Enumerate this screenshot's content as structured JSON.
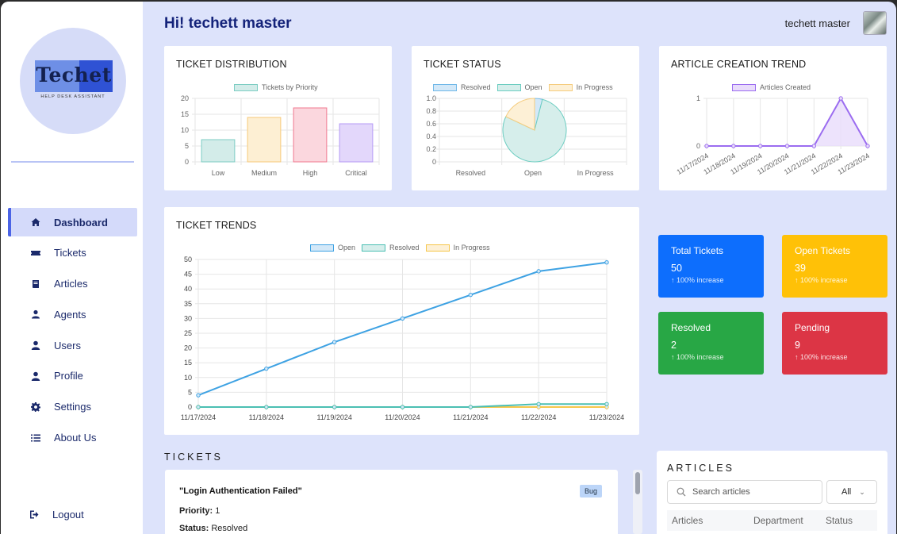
{
  "app": {
    "greeting": "Hi! techett master",
    "user_name": "techett master"
  },
  "logo": {
    "text": "Techet",
    "subtitle": "HELP DESK ASSISTANT"
  },
  "sidebar": {
    "items": [
      {
        "label": "Dashboard",
        "icon": "home-icon"
      },
      {
        "label": "Tickets",
        "icon": "ticket-icon"
      },
      {
        "label": "Articles",
        "icon": "book-icon"
      },
      {
        "label": "Agents",
        "icon": "agent-icon"
      },
      {
        "label": "Users",
        "icon": "user-icon"
      },
      {
        "label": "Profile",
        "icon": "profile-icon"
      },
      {
        "label": "Settings",
        "icon": "gear-icon"
      },
      {
        "label": "About Us",
        "icon": "list-icon"
      }
    ],
    "logout": "Logout"
  },
  "charts": {
    "distribution_title": "TICKET DISTRIBUTION",
    "status_title": "TICKET STATUS",
    "article_title": "ARTICLE CREATION TREND",
    "trends_title": "TICKET TRENDS"
  },
  "chart_data": [
    {
      "type": "bar",
      "title": "TICKET DISTRIBUTION",
      "categories": [
        "Low",
        "Medium",
        "High",
        "Critical"
      ],
      "series": [
        {
          "name": "Tickets by Priority",
          "values": [
            7,
            14,
            17,
            12
          ]
        }
      ],
      "colors": [
        "#d3ece9",
        "#fdefd3",
        "#fbd7de",
        "#e3d7fb"
      ],
      "borders": [
        "#7ccdc3",
        "#f7c978",
        "#f0788f",
        "#b49af5"
      ],
      "yticks": [
        0,
        5,
        10,
        15,
        20
      ],
      "ylim": [
        0,
        20
      ]
    },
    {
      "type": "pie",
      "title": "TICKET STATUS",
      "categories": [
        "Resolved",
        "Open",
        "In Progress"
      ],
      "values": [
        2,
        39,
        9
      ],
      "colors": [
        "#d3e8f8",
        "#d6eeeb",
        "#fdf0d6"
      ],
      "borders": [
        "#6fb8e8",
        "#6ccdc1",
        "#f5cc7e"
      ],
      "yticks": [
        "0",
        "0.2",
        "0.4",
        "0.6",
        "0.8",
        "1.0"
      ]
    },
    {
      "type": "area",
      "title": "ARTICLE CREATION TREND",
      "x": [
        "11/17/2024",
        "11/18/2024",
        "11/19/2024",
        "11/20/2024",
        "11/21/2024",
        "11/22/2024",
        "11/23/2024"
      ],
      "series": [
        {
          "name": "Articles Created",
          "values": [
            0,
            0,
            0,
            0,
            0,
            1,
            0
          ]
        }
      ],
      "color": "#9b6cf0",
      "ylim": [
        0,
        1
      ],
      "yticks": [
        0,
        1
      ]
    },
    {
      "type": "line",
      "title": "TICKET TRENDS",
      "x": [
        "11/17/2024",
        "11/18/2024",
        "11/19/2024",
        "11/20/2024",
        "11/21/2024",
        "11/22/2024",
        "11/23/2024"
      ],
      "series": [
        {
          "name": "Open",
          "values": [
            4,
            13,
            22,
            30,
            38,
            46,
            49
          ],
          "color": "#3ea2e3"
        },
        {
          "name": "Resolved",
          "values": [
            0,
            0,
            0,
            0,
            0,
            1,
            1
          ],
          "color": "#4bbfb3"
        },
        {
          "name": "In Progress",
          "values": [
            0,
            0,
            0,
            0,
            0,
            0,
            0
          ],
          "color": "#f5c64a"
        }
      ],
      "ylim": [
        0,
        50
      ],
      "yticks": [
        0,
        5,
        10,
        15,
        20,
        25,
        30,
        35,
        40,
        45,
        50
      ]
    }
  ],
  "stats": [
    {
      "title": "Total Tickets",
      "value": "50",
      "change": "↑ 100% increase",
      "color": "#0d6efd"
    },
    {
      "title": "Open Tickets",
      "value": "39",
      "change": "↑ 100% increase",
      "color": "#ffc107"
    },
    {
      "title": "Resolved",
      "value": "2",
      "change": "↑ 100% increase",
      "color": "#28a745"
    },
    {
      "title": "Pending",
      "value": "9",
      "change": "↑ 100% increase",
      "color": "#dc3545"
    }
  ],
  "tickets": {
    "section_title": "TICKETS",
    "items": [
      {
        "title": "\"Login Authentication Failed\"",
        "badge": "Bug",
        "priority_label": "Priority:",
        "priority": "1",
        "status_label": "Status:",
        "status": "Resolved"
      }
    ]
  },
  "articles": {
    "section_title": "ARTICLES",
    "search_placeholder": "Search articles",
    "filter_value": "All",
    "columns": [
      "Articles",
      "Department",
      "Status"
    ]
  }
}
